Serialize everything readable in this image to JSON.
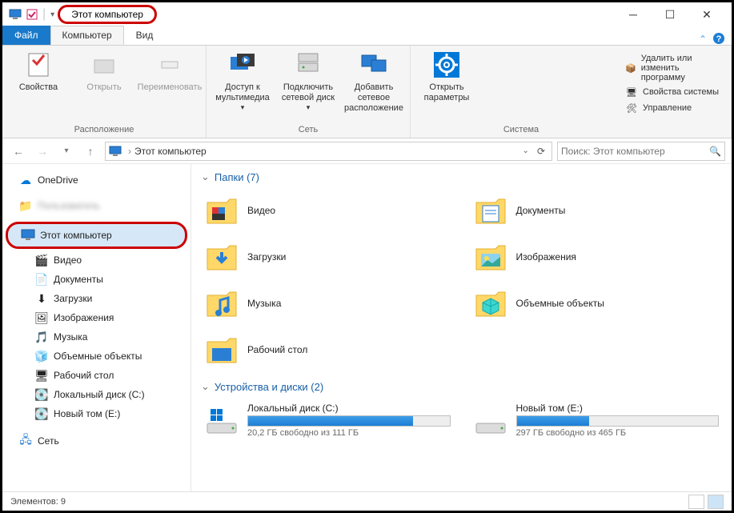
{
  "title": "Этот компьютер",
  "tabs": {
    "file": "Файл",
    "computer": "Компьютер",
    "view": "Вид"
  },
  "ribbon": {
    "location": {
      "label": "Расположение",
      "properties": "Свойства",
      "open": "Открыть",
      "rename": "Переименовать"
    },
    "network": {
      "label": "Сеть",
      "media": "Доступ к мультимедиа",
      "map": "Подключить сетевой диск",
      "add": "Добавить сетевое расположение"
    },
    "system": {
      "label": "Система",
      "open": "Открыть параметры",
      "uninstall": "Удалить или изменить программу",
      "props": "Свойства системы",
      "manage": "Управление"
    }
  },
  "breadcrumb": "Этот компьютер",
  "search_placeholder": "Поиск: Этот компьютер",
  "nav": {
    "onedrive": "OneDrive",
    "thispc": "Этот компьютер",
    "items": [
      "Видео",
      "Документы",
      "Загрузки",
      "Изображения",
      "Музыка",
      "Объемные объекты",
      "Рабочий стол",
      "Локальный диск (C:)",
      "Новый том (E:)"
    ],
    "network": "Сеть"
  },
  "folders_header": "Папки (7)",
  "folders": [
    {
      "name": "Видео"
    },
    {
      "name": "Документы"
    },
    {
      "name": "Загрузки"
    },
    {
      "name": "Изображения"
    },
    {
      "name": "Музыка"
    },
    {
      "name": "Объемные объекты"
    },
    {
      "name": "Рабочий стол"
    }
  ],
  "drives_header": "Устройства и диски (2)",
  "drives": [
    {
      "name": "Локальный диск (C:)",
      "free_text": "20,2 ГБ свободно из 111 ГБ",
      "fill_pct": 82
    },
    {
      "name": "Новый том (E:)",
      "free_text": "297 ГБ свободно из 465 ГБ",
      "fill_pct": 36
    }
  ],
  "status": "Элементов: 9"
}
